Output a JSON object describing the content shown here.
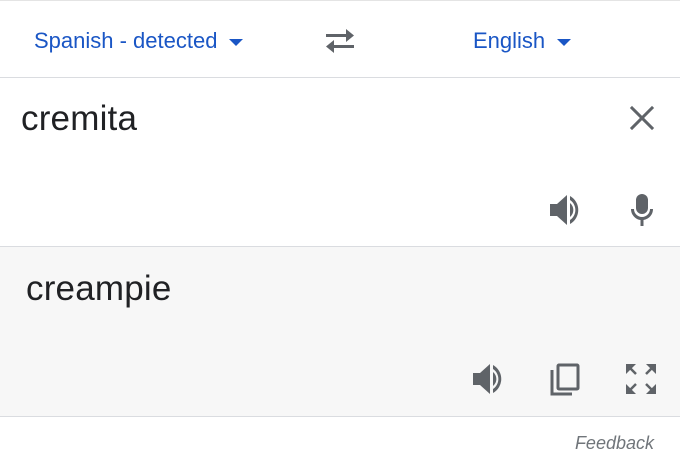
{
  "language_bar": {
    "source_language": "Spanish - detected",
    "target_language": "English",
    "source_dropdown_icon": "caret-down-icon",
    "target_dropdown_icon": "caret-down-icon",
    "swap_icon": "swap-arrows-icon"
  },
  "source": {
    "text": "cremita",
    "icons": [
      "close-icon",
      "speaker-icon",
      "microphone-icon"
    ]
  },
  "result": {
    "text": "creampie",
    "icons": [
      "speaker-icon",
      "copy-icon",
      "fullscreen-icon"
    ]
  },
  "footer": {
    "feedback_label": "Feedback"
  },
  "colors": {
    "link_blue": "#1a56c5",
    "text_primary": "#202124",
    "icon_gray": "#5f6368",
    "result_background": "#f7f7f7",
    "divider": "#dadce0"
  }
}
